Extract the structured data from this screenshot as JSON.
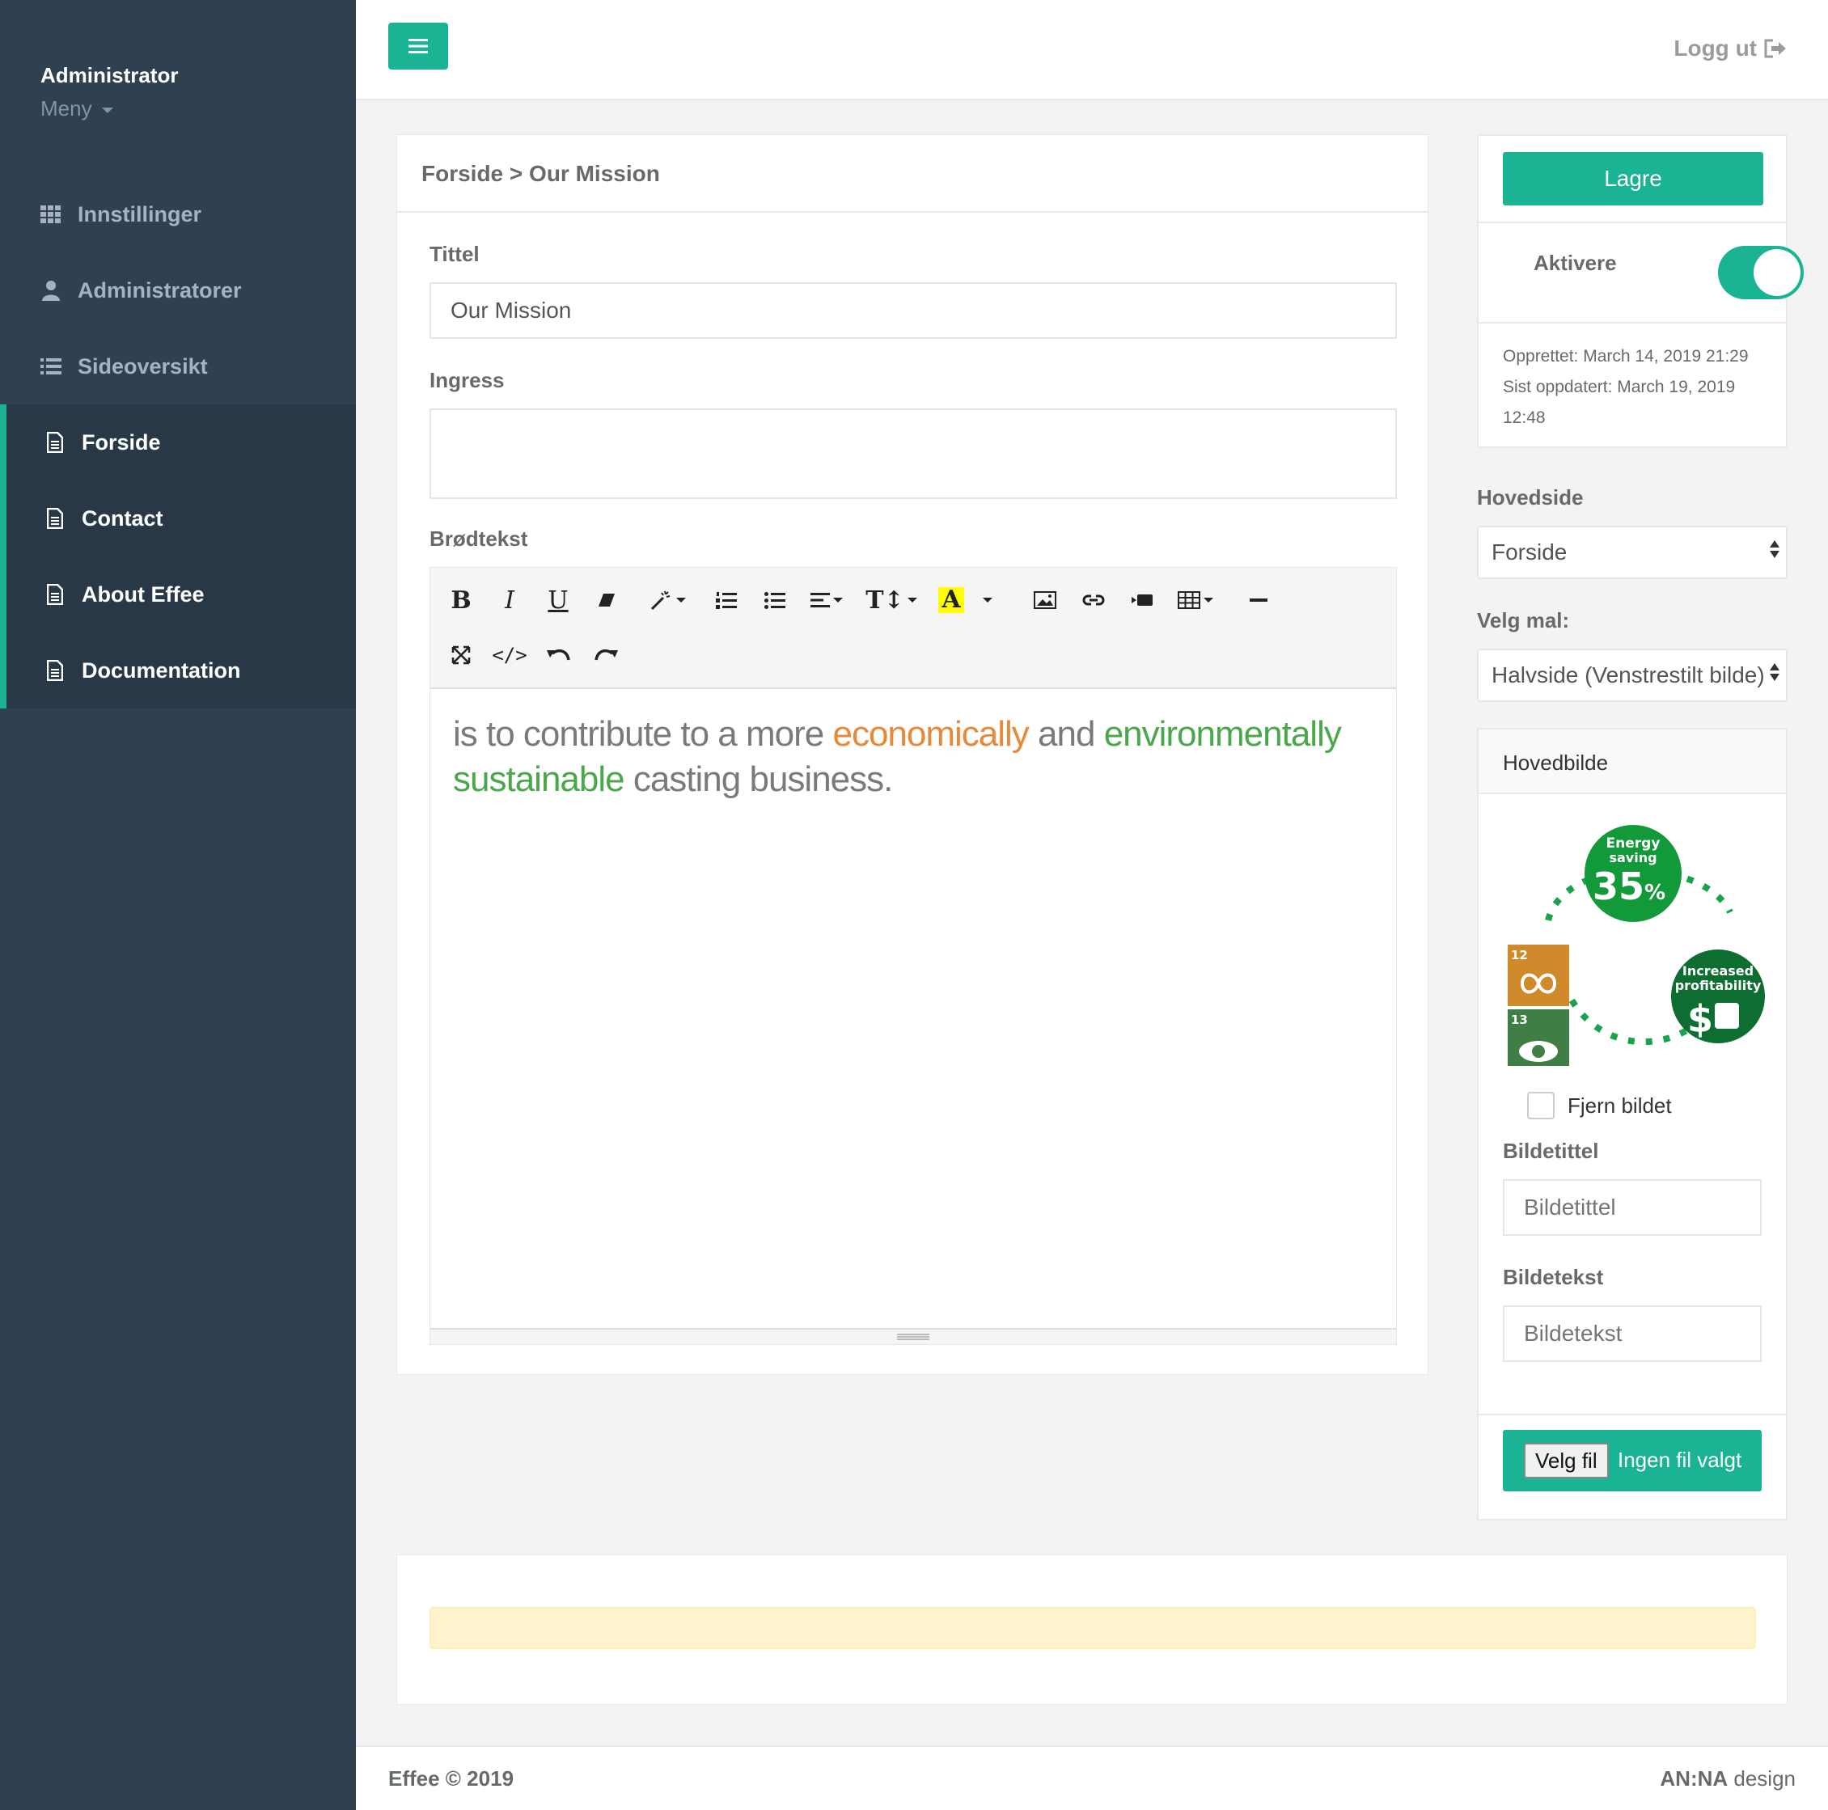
{
  "sidebar": {
    "user_name": "Administrator",
    "menu_label": "Meny",
    "items": [
      {
        "label": "Innstillinger",
        "icon": "grid-icon"
      },
      {
        "label": "Administratorer",
        "icon": "user-icon"
      },
      {
        "label": "Sideoversikt",
        "icon": "list-icon"
      }
    ],
    "pages": [
      {
        "label": "Forside",
        "icon": "file-icon"
      },
      {
        "label": "Contact",
        "icon": "file-icon"
      },
      {
        "label": "About Effee",
        "icon": "file-icon"
      },
      {
        "label": "Documentation",
        "icon": "file-icon"
      }
    ]
  },
  "topbar": {
    "logout_label": "Logg ut"
  },
  "panel": {
    "breadcrumb": "Forside > Our Mission",
    "title_label": "Tittel",
    "title_value": "Our Mission",
    "ingress_label": "Ingress",
    "ingress_value": "",
    "body_label": "Brødtekst",
    "body_text": {
      "part1": "is to contribute to a more ",
      "word_orange": "economically",
      "part2": " and ",
      "word_green1": "environmentally",
      "word_green2": "sustainable",
      "part3": " casting business."
    },
    "colors": {
      "orange": "#e8893a",
      "green": "#4aa84a",
      "accent": "#1ab394"
    }
  },
  "right": {
    "save_label": "Lagre",
    "activate_label": "Aktivere",
    "activate_on": true,
    "created": "Opprettet: March 14, 2019 21:29",
    "updated_line1": "Sist oppdatert: March 19, 2019",
    "updated_line2": "12:48",
    "mainpage_label": "Hovedside",
    "mainpage_value": "Forside",
    "template_label": "Velg mal:",
    "template_value": "Halvside (Venstrestilt bilde)",
    "image_head": "Hovedbilde",
    "image": {
      "energy_line1": "Energy",
      "energy_line2": "saving",
      "energy_value": "35",
      "energy_unit": "%",
      "profit_line1": "Increased",
      "profit_line2": "profitability",
      "sdg12_num": "12",
      "sdg13_num": "13"
    },
    "remove_image_label": "Fjern bildet",
    "image_title_label": "Bildetittel",
    "image_title_placeholder": "Bildetittel",
    "image_text_label": "Bildetekst",
    "image_text_placeholder": "Bildetekst",
    "choose_file_label": "Velg fil",
    "no_file_label": "Ingen fil valgt"
  },
  "footer": {
    "copyright": "Effee © 2019",
    "credit_bold": "AN:NA",
    "credit_rest": " design"
  }
}
